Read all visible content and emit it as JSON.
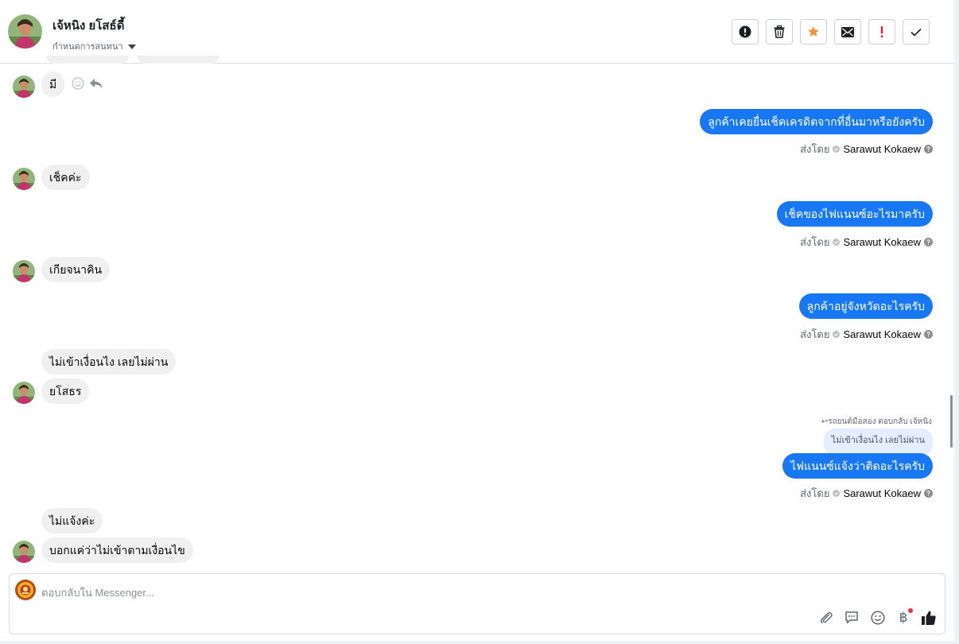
{
  "header": {
    "contact_name": "เจ้หนิง ยโสธ์ดี้",
    "conversation_setting": "กำหนดการสนทนา"
  },
  "actions": [
    {
      "id": "report",
      "icon": "alert-circle-icon"
    },
    {
      "id": "delete",
      "icon": "trash-icon"
    },
    {
      "id": "star",
      "icon": "star-icon",
      "color": "#f7923b"
    },
    {
      "id": "mark-unread",
      "icon": "envelope-icon"
    },
    {
      "id": "follow-up",
      "icon": "exclamation-icon",
      "color": "#e41e3f"
    },
    {
      "id": "done",
      "icon": "checkmark-icon"
    }
  ],
  "sender_label": "ส่งโดย",
  "agent_name": "Sarawut Kokaew",
  "messages": [
    {
      "direction": "in",
      "text": "มี"
    },
    {
      "direction": "out",
      "text": "ลูกค้าเคยยื่นเช็คเครดิตจากที่อื่นมาหรือยังครับ"
    },
    {
      "direction": "in",
      "text": "เช็คค่ะ"
    },
    {
      "direction": "out",
      "text": "เช็คของไฟแนนซ์อะไรมาครับ"
    },
    {
      "direction": "in",
      "text": "เกียจนาคิน"
    },
    {
      "direction": "out",
      "text": "ลูกค้าอยู่จังหวัดอะไรครับ"
    },
    {
      "direction": "in",
      "text": "ไม่เข้าเงื่อนไง เลยไม่ผ่าน"
    },
    {
      "direction": "in",
      "text": "ยโสธร"
    },
    {
      "direction": "out",
      "text": "ไฟแนนซ์แจ้งว่าติดอะไรครับ",
      "reply_caption": "↩รถยนต์มือสอง ตอบกลับ เจ้หนิง",
      "quoted": "ไม่เข้าเงื่อนไง เลยไม่ผ่าน"
    },
    {
      "direction": "in",
      "text": "ไม่แจ้งค่ะ"
    },
    {
      "direction": "in",
      "text": "บอกแค่ว่าไม่เข้าตามเงื่อนไข"
    }
  ],
  "composer": {
    "placeholder": "ตอบกลับใน Messenger...",
    "value": "",
    "tools": [
      "paperclip-icon",
      "speech-bubble-icon",
      "emoji-icon",
      "baht-icon",
      "thumbs-up-icon"
    ],
    "baht_symbol": "฿"
  },
  "colors": {
    "accent": "#1877f2",
    "incoming_bubble": "#f0f0f0",
    "quote_bubble": "#e4eefe"
  }
}
